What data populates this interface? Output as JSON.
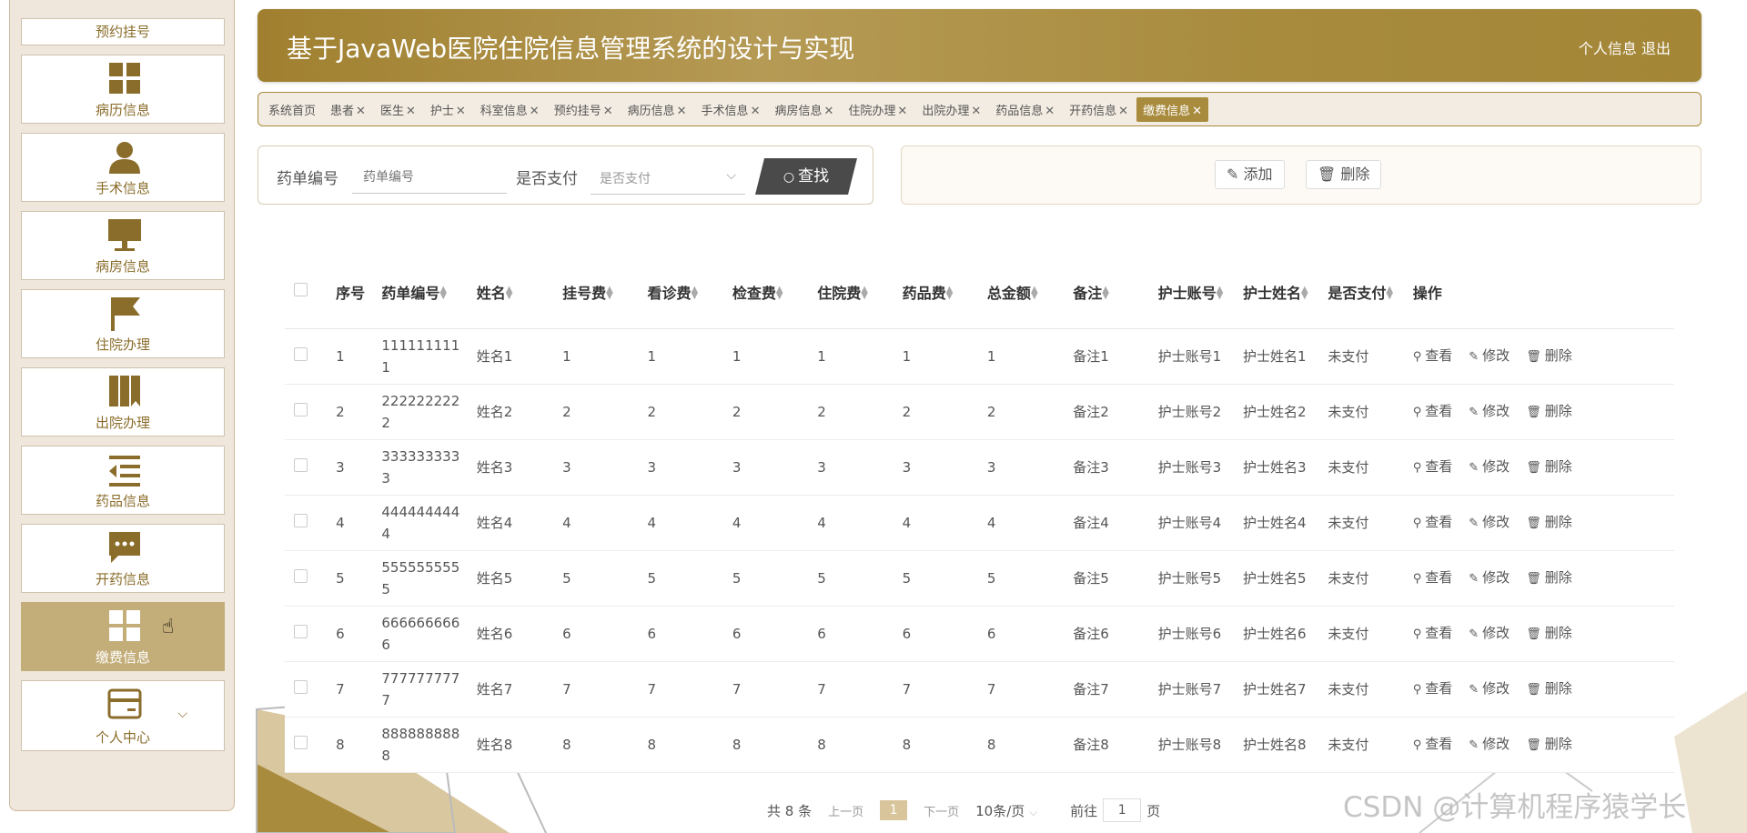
{
  "app": {
    "title": "基于JavaWeb医院住院信息管理系统的设计与实现",
    "profile_link": "个人信息",
    "logout_link": "退出"
  },
  "colors": {
    "brand": "#a88b3d",
    "brand_light": "#c3ad78",
    "sidebar_bg": "#efe6dc"
  },
  "sidebar": {
    "top_item": "预约挂号",
    "items": [
      {
        "label": "病历信息",
        "icon": "grid-icon"
      },
      {
        "label": "手术信息",
        "icon": "person-icon"
      },
      {
        "label": "病房信息",
        "icon": "monitor-icon"
      },
      {
        "label": "住院办理",
        "icon": "flag-icon"
      },
      {
        "label": "出院办理",
        "icon": "book-icon"
      },
      {
        "label": "药品信息",
        "icon": "list-indent-icon"
      },
      {
        "label": "开药信息",
        "icon": "chat-icon"
      },
      {
        "label": "缴费信息",
        "icon": "grid-icon",
        "active": true
      },
      {
        "label": "个人中心",
        "icon": "card-icon",
        "expandable": true
      }
    ]
  },
  "tabs": [
    {
      "label": "系统首页",
      "closable": false
    },
    {
      "label": "患者",
      "closable": true
    },
    {
      "label": "医生",
      "closable": true
    },
    {
      "label": "护士",
      "closable": true
    },
    {
      "label": "科室信息",
      "closable": true
    },
    {
      "label": "预约挂号",
      "closable": true
    },
    {
      "label": "病历信息",
      "closable": true
    },
    {
      "label": "手术信息",
      "closable": true
    },
    {
      "label": "病房信息",
      "closable": true
    },
    {
      "label": "住院办理",
      "closable": true
    },
    {
      "label": "出院办理",
      "closable": true
    },
    {
      "label": "药品信息",
      "closable": true
    },
    {
      "label": "开药信息",
      "closable": true
    },
    {
      "label": "缴费信息",
      "closable": true,
      "active": true
    }
  ],
  "tab_close_glyph": "✕",
  "search": {
    "field1_label": "药单编号",
    "field1_placeholder": "药单编号",
    "field2_label": "是否支付",
    "field2_placeholder": "是否支付",
    "button_label": "查找"
  },
  "actions": {
    "add_label": "添加",
    "delete_label": "删除"
  },
  "table": {
    "columns": [
      {
        "key": "seq",
        "label": "序号",
        "sortable": false
      },
      {
        "key": "code",
        "label": "药单编号",
        "sortable": true
      },
      {
        "key": "name",
        "label": "姓名",
        "sortable": true
      },
      {
        "key": "reg_fee",
        "label": "挂号费",
        "sortable": true
      },
      {
        "key": "consult_fee",
        "label": "看诊费",
        "sortable": true
      },
      {
        "key": "exam_fee",
        "label": "检查费",
        "sortable": true
      },
      {
        "key": "hosp_fee",
        "label": "住院费",
        "sortable": true
      },
      {
        "key": "drug_fee",
        "label": "药品费",
        "sortable": true
      },
      {
        "key": "total",
        "label": "总金额",
        "sortable": true
      },
      {
        "key": "note",
        "label": "备注",
        "sortable": true
      },
      {
        "key": "nurse_account",
        "label": "护士账号",
        "sortable": true
      },
      {
        "key": "nurse_name",
        "label": "护士姓名",
        "sortable": true
      },
      {
        "key": "paid",
        "label": "是否支付",
        "sortable": true
      },
      {
        "key": "ops",
        "label": "操作",
        "sortable": false
      }
    ],
    "row_actions": {
      "view": "查看",
      "edit": "修改",
      "delete": "删除"
    },
    "rows": [
      {
        "seq": "1",
        "code": "1111111111",
        "name": "姓名1",
        "reg_fee": "1",
        "consult_fee": "1",
        "exam_fee": "1",
        "hosp_fee": "1",
        "drug_fee": "1",
        "total": "1",
        "note": "备注1",
        "nurse_account": "护士账号1",
        "nurse_name": "护士姓名1",
        "paid": "未支付"
      },
      {
        "seq": "2",
        "code": "2222222222",
        "name": "姓名2",
        "reg_fee": "2",
        "consult_fee": "2",
        "exam_fee": "2",
        "hosp_fee": "2",
        "drug_fee": "2",
        "total": "2",
        "note": "备注2",
        "nurse_account": "护士账号2",
        "nurse_name": "护士姓名2",
        "paid": "未支付"
      },
      {
        "seq": "3",
        "code": "3333333333",
        "name": "姓名3",
        "reg_fee": "3",
        "consult_fee": "3",
        "exam_fee": "3",
        "hosp_fee": "3",
        "drug_fee": "3",
        "total": "3",
        "note": "备注3",
        "nurse_account": "护士账号3",
        "nurse_name": "护士姓名3",
        "paid": "未支付"
      },
      {
        "seq": "4",
        "code": "4444444444",
        "name": "姓名4",
        "reg_fee": "4",
        "consult_fee": "4",
        "exam_fee": "4",
        "hosp_fee": "4",
        "drug_fee": "4",
        "total": "4",
        "note": "备注4",
        "nurse_account": "护士账号4",
        "nurse_name": "护士姓名4",
        "paid": "未支付"
      },
      {
        "seq": "5",
        "code": "5555555555",
        "name": "姓名5",
        "reg_fee": "5",
        "consult_fee": "5",
        "exam_fee": "5",
        "hosp_fee": "5",
        "drug_fee": "5",
        "total": "5",
        "note": "备注5",
        "nurse_account": "护士账号5",
        "nurse_name": "护士姓名5",
        "paid": "未支付"
      },
      {
        "seq": "6",
        "code": "6666666666",
        "name": "姓名6",
        "reg_fee": "6",
        "consult_fee": "6",
        "exam_fee": "6",
        "hosp_fee": "6",
        "drug_fee": "6",
        "total": "6",
        "note": "备注6",
        "nurse_account": "护士账号6",
        "nurse_name": "护士姓名6",
        "paid": "未支付"
      },
      {
        "seq": "7",
        "code": "7777777777",
        "name": "姓名7",
        "reg_fee": "7",
        "consult_fee": "7",
        "exam_fee": "7",
        "hosp_fee": "7",
        "drug_fee": "7",
        "total": "7",
        "note": "备注7",
        "nurse_account": "护士账号7",
        "nurse_name": "护士姓名7",
        "paid": "未支付"
      },
      {
        "seq": "8",
        "code": "8888888888",
        "name": "姓名8",
        "reg_fee": "8",
        "consult_fee": "8",
        "exam_fee": "8",
        "hosp_fee": "8",
        "drug_fee": "8",
        "total": "8",
        "note": "备注8",
        "nurse_account": "护士账号8",
        "nurse_name": "护士姓名8",
        "paid": "未支付"
      }
    ]
  },
  "pagination": {
    "total_text": "共 8 条",
    "prev": "上一页",
    "current": "1",
    "next": "下一页",
    "page_size": "10条/页",
    "goto_prefix": "前往",
    "goto_value": "1",
    "goto_suffix": "页"
  },
  "watermark": "CSDN @计算机程序猿学长"
}
